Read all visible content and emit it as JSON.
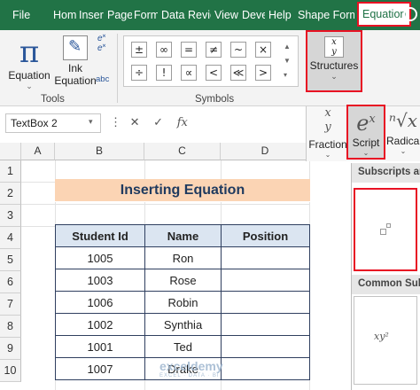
{
  "ribbon_tabs": [
    "File",
    "Hom",
    "Inser",
    "Page",
    "Form",
    "Data",
    "Revie",
    "View",
    "Deve",
    "Help",
    "Shape Format",
    "Equation"
  ],
  "active_tab": "Equation",
  "tools": {
    "equation_label": "Equation",
    "ink_label": "Ink",
    "ink_label2": "Equation",
    "group_label": "Tools",
    "abc": "abc"
  },
  "symbols": {
    "group_label": "Symbols",
    "row1": [
      "±",
      "∞",
      "=",
      "≠",
      "~",
      "×"
    ],
    "row2": [
      "÷",
      "!",
      "∝",
      "<",
      "≪",
      ">"
    ]
  },
  "structures": {
    "label": "Structures",
    "icon_num": "x",
    "icon_den": "y"
  },
  "gallery": {
    "fraction": "Fraction",
    "script": "Script",
    "radical": "Radical",
    "subscripts_header": "Subscripts and Superscripts",
    "common_header": "Common Subscripts",
    "common_sample": "xy²"
  },
  "formula_bar": {
    "name_box": "TextBox 2",
    "fx": "fx"
  },
  "columns": [
    "A",
    "B",
    "C",
    "D"
  ],
  "rows": [
    "1",
    "2",
    "3",
    "4",
    "5",
    "6",
    "7",
    "8",
    "9",
    "10"
  ],
  "sheet": {
    "title": "Inserting Equation",
    "headers": [
      "Student Id",
      "Name",
      "Position"
    ],
    "table": [
      [
        "1005",
        "Ron",
        ""
      ],
      [
        "1003",
        "Rose",
        ""
      ],
      [
        "1006",
        "Robin",
        ""
      ],
      [
        "1002",
        "Synthia",
        ""
      ],
      [
        "1001",
        "Ted",
        ""
      ],
      [
        "1007",
        "Drake",
        ""
      ]
    ]
  },
  "watermark": {
    "name": "exceldemy",
    "tagline": "EXCEL · DATA · BI"
  },
  "colors": {
    "ribbon_green": "#217346",
    "highlight_red": "#e81123",
    "title_fill": "#fbd4b4",
    "header_fill": "#dbe5f1"
  }
}
